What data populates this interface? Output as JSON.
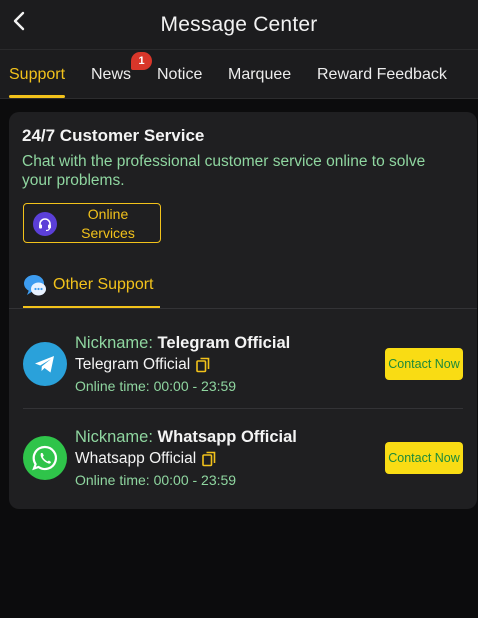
{
  "header": {
    "title": "Message Center",
    "back_icon": "chevron-left-icon"
  },
  "tabs": [
    {
      "label": "Support",
      "active": true
    },
    {
      "label": "News",
      "badge": "1"
    },
    {
      "label": "Notice"
    },
    {
      "label": "Marquee"
    },
    {
      "label": "Reward Feedback"
    }
  ],
  "customer_service": {
    "title": "24/7 Customer Service",
    "description": "Chat with the professional customer service online to solve your problems.",
    "online_button": {
      "label": "Online Services",
      "icon": "headset-icon"
    }
  },
  "other_support": {
    "label": "Other Support",
    "icon": "chat-bubbles-icon",
    "contacts": [
      {
        "nickname_label": "Nickname:",
        "nickname": "Telegram Official",
        "account": "Telegram Official",
        "online_time": "Online time: 00:00 - 23:59",
        "contact_label": "Contact Now",
        "icon": "telegram-icon",
        "color": "#2aa1da"
      },
      {
        "nickname_label": "Nickname:",
        "nickname": "Whatsapp Official",
        "account": "Whatsapp Official",
        "online_time": "Online time: 00:00 - 23:59",
        "contact_label": "Contact Now",
        "icon": "whatsapp-icon",
        "color": "#2fc44a"
      }
    ]
  },
  "colors": {
    "accent": "#f2c21b",
    "green_text": "#8fd6a0",
    "badge": "#d9362a",
    "button_fill": "#f9dc14"
  }
}
